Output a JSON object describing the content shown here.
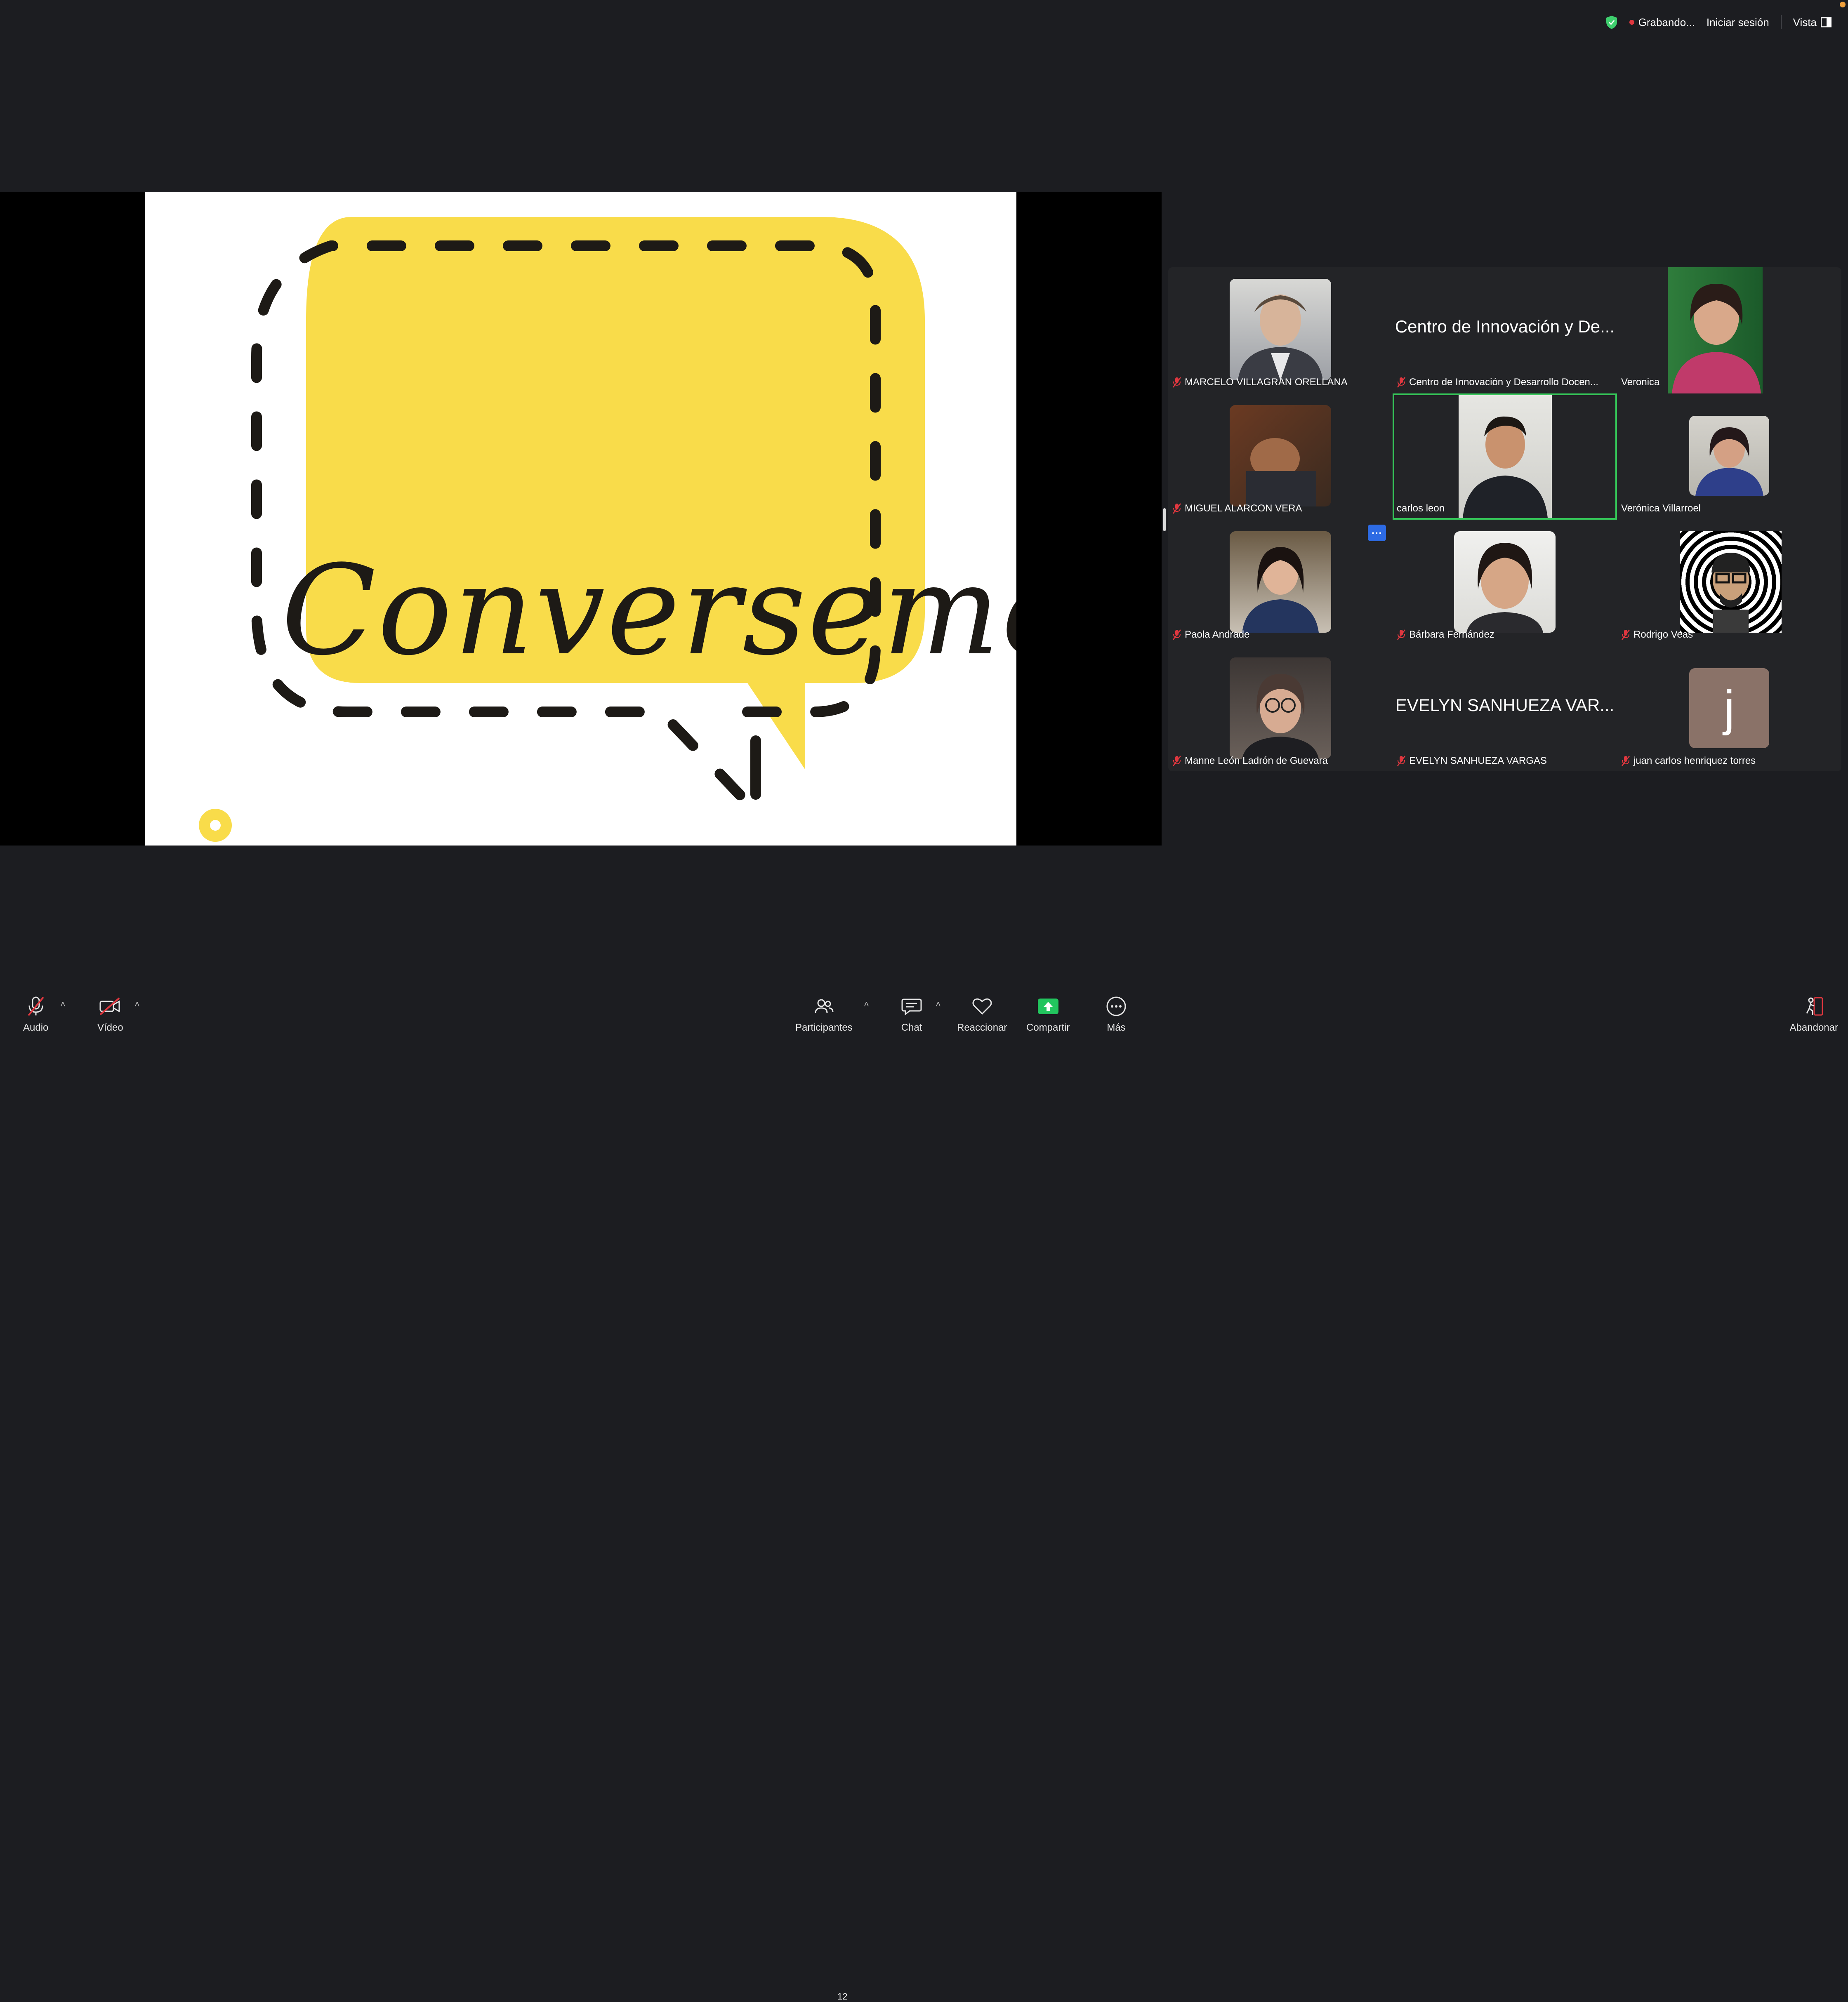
{
  "topbar": {
    "recording_label": "Grabando...",
    "signin_label": "Iniciar sesión",
    "view_label": "Vista"
  },
  "slide": {
    "title": "Conversemos",
    "accent_color": "#f9dc4a"
  },
  "participants": [
    {
      "name": "MARCELO VILLAGRAN ORELLANA",
      "muted": true,
      "video": true
    },
    {
      "name": "Centro de Innovación y Desarrollo Docen...",
      "display": "Centro de Innovación y De...",
      "muted": true,
      "video": false
    },
    {
      "name": "Veronica",
      "muted": false,
      "video": true
    },
    {
      "name": "MIGUEL ALARCON VERA",
      "muted": true,
      "video": true
    },
    {
      "name": "carlos leon",
      "muted": false,
      "video": true,
      "speaking": true
    },
    {
      "name": "Verónica Villarroel",
      "muted": false,
      "video": true
    },
    {
      "name": "Paola Andrade",
      "muted": true,
      "video": true
    },
    {
      "name": "Bárbara Fernández",
      "muted": true,
      "video": true
    },
    {
      "name": "Rodrigo Veas",
      "muted": true,
      "video": true
    },
    {
      "name": "Manne León Ladrón de Guevara",
      "muted": true,
      "video": true
    },
    {
      "name": "EVELYN SANHUEZA VARGAS",
      "display": "EVELYN SANHUEZA VAR...",
      "muted": true,
      "video": false
    },
    {
      "name": "juan carlos henriquez torres",
      "initial": "j",
      "muted": true,
      "video": false
    }
  ],
  "toolbar": {
    "audio": "Audio",
    "video": "Vídeo",
    "participants": "Participantes",
    "participants_count": "12",
    "chat": "Chat",
    "react": "Reaccionar",
    "share": "Compartir",
    "more": "Más",
    "leave": "Abandonar"
  },
  "colors": {
    "background": "#1c1d21",
    "grid_bg": "#232427",
    "active_speaker": "#35c759",
    "share_green": "#22c55e",
    "muted_red": "#e0373f"
  }
}
